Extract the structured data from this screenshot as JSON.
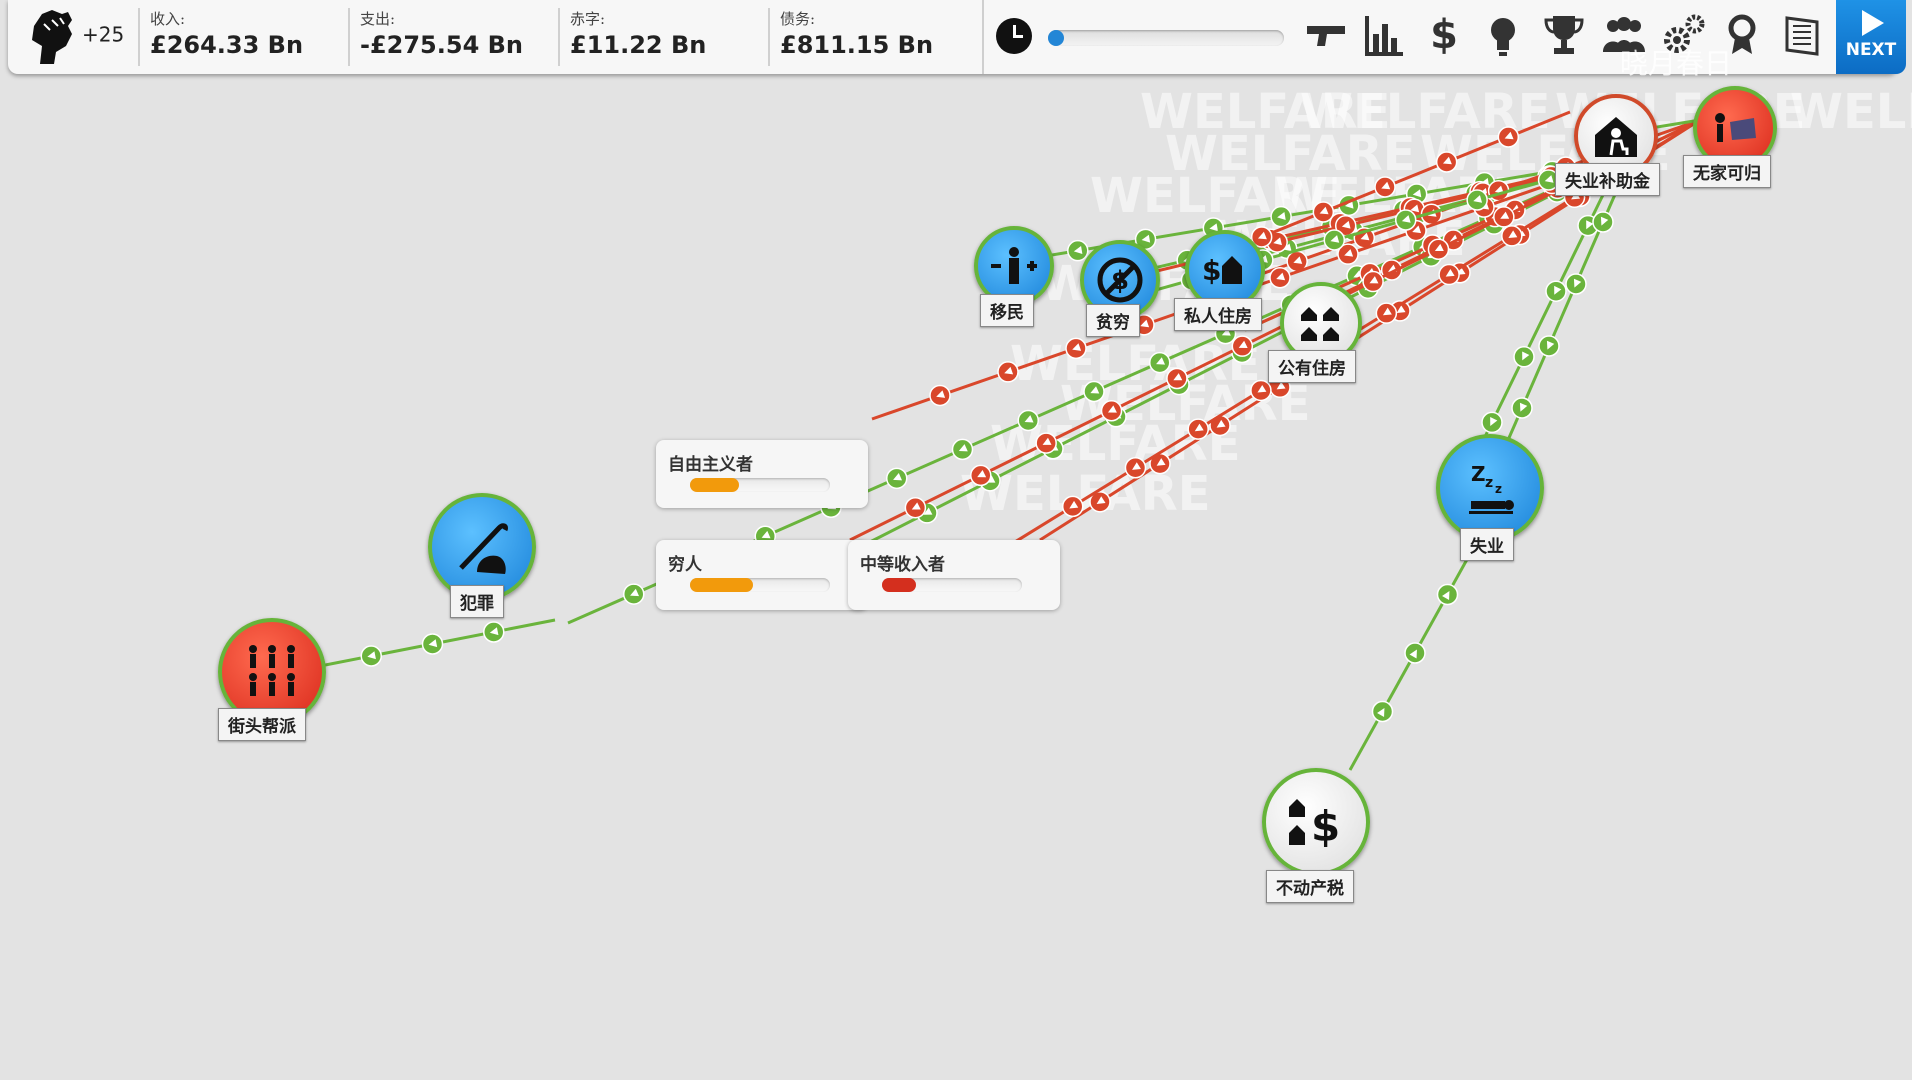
{
  "topbar": {
    "capital": "+25",
    "income": {
      "label": "收入:",
      "value": "£264.33 Bn"
    },
    "spending": {
      "label": "支出:",
      "value": "-£275.54 Bn"
    },
    "deficit": {
      "label": "赤字:",
      "value": "£11.22 Bn"
    },
    "debt": {
      "label": "债务:",
      "value": "£811.15 Bn"
    },
    "next_label": "NEXT",
    "timeline_progress": 0.03
  },
  "watermark": "WELFARE",
  "overlay_watermark": "晓月春日",
  "nodes": {
    "unemployment_benefit": "失业补助金",
    "homeless": "无家可归",
    "immigration": "移民",
    "poverty": "贫穷",
    "private_housing": "私人住房",
    "public_housing": "公有住房",
    "crime": "犯罪",
    "street_gangs": "街头帮派",
    "unemployment": "失业",
    "property_tax": "不动产税"
  },
  "groups": {
    "liberal": {
      "label": "自由主义者",
      "level": 0.35,
      "color": "#f29a0c"
    },
    "poor": {
      "label": "穷人",
      "level": 0.45,
      "color": "#f29a0c"
    },
    "middle": {
      "label": "中等收入者",
      "level": 0.24,
      "color": "#d42f1e"
    }
  },
  "colors": {
    "positive": "#6ab43c",
    "negative": "#d9472b",
    "accent": "#1a82d8"
  }
}
